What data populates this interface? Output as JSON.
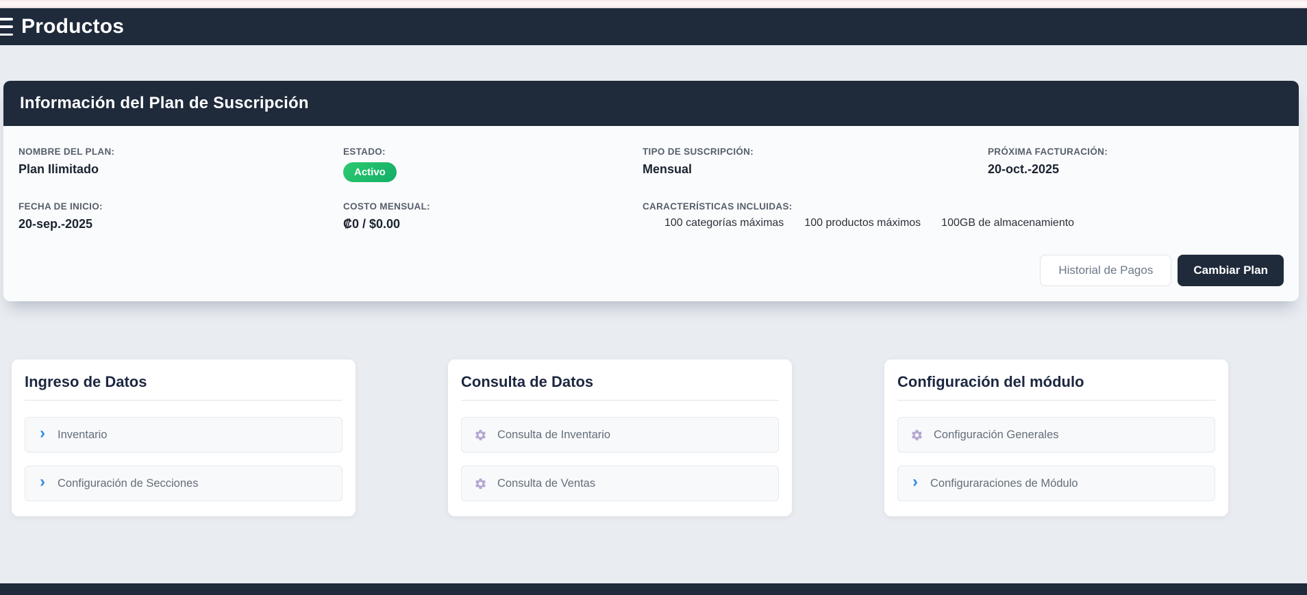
{
  "colors": {
    "dark_navy": "#1f2a3b",
    "page_bg": "#e9ecf1",
    "badge_green": "#1cbd6d",
    "chevron_blue": "#2e8be6",
    "gear_purple": "#b5a7d3"
  },
  "header": {
    "title": "Productos",
    "menu_icon": "hamburger-icon"
  },
  "plan_panel": {
    "title": "Información del Plan de Suscripción",
    "fields": {
      "plan_name": {
        "label": "NOMBRE DEL PLAN:",
        "value": "Plan Ilimitado"
      },
      "status": {
        "label": "ESTADO:",
        "value": "Activo"
      },
      "subscription_type": {
        "label": "TIPO DE SUSCRIPCIÓN:",
        "value": "Mensual"
      },
      "next_billing": {
        "label": "PRÓXIMA FACTURACIÓN:",
        "value": "20-oct.-2025"
      },
      "start_date": {
        "label": "FECHA DE INICIO:",
        "value": "20-sep.-2025"
      },
      "monthly_cost": {
        "label": "COSTO MENSUAL:",
        "value": "₡0 / $0.00"
      },
      "included_features": {
        "label": "CARACTERÍSTICAS INCLUIDAS:"
      }
    },
    "features": [
      "100 categorías máximas",
      "100 productos máximos",
      "100GB de almacenamiento"
    ],
    "actions": {
      "payment_history": "Historial de Pagos",
      "change_plan": "Cambiar Plan"
    }
  },
  "cards": [
    {
      "title": "Ingreso de Datos",
      "items": [
        {
          "icon": "chevron",
          "label": "Inventario"
        },
        {
          "icon": "chevron",
          "label": "Configuración de Secciones"
        }
      ]
    },
    {
      "title": "Consulta de Datos",
      "items": [
        {
          "icon": "gear",
          "label": "Consulta de Inventario"
        },
        {
          "icon": "gear",
          "label": "Consulta de Ventas"
        }
      ]
    },
    {
      "title": "Configuración del módulo",
      "items": [
        {
          "icon": "gear",
          "label": "Configuración Generales"
        },
        {
          "icon": "chevron",
          "label": "Configuraraciones de Módulo"
        }
      ]
    }
  ]
}
